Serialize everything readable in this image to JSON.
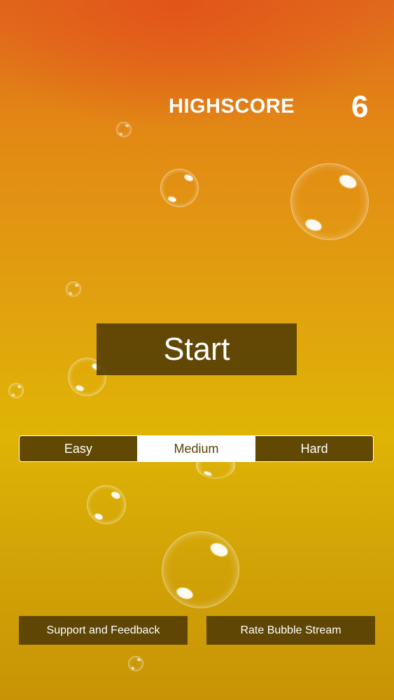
{
  "header": {
    "highscore_label": "HIGHSCORE",
    "highscore_value": "6"
  },
  "main": {
    "start_label": "Start"
  },
  "difficulty": {
    "options": [
      "Easy",
      "Medium",
      "Hard"
    ],
    "selected": "Medium"
  },
  "footer": {
    "support_label": "Support and Feedback",
    "rate_label": "Rate Bubble Stream"
  },
  "colors": {
    "background_top": "#e06a1c",
    "background_bottom": "#c89405",
    "button_fill": "#503a05",
    "text": "#ffffff"
  }
}
